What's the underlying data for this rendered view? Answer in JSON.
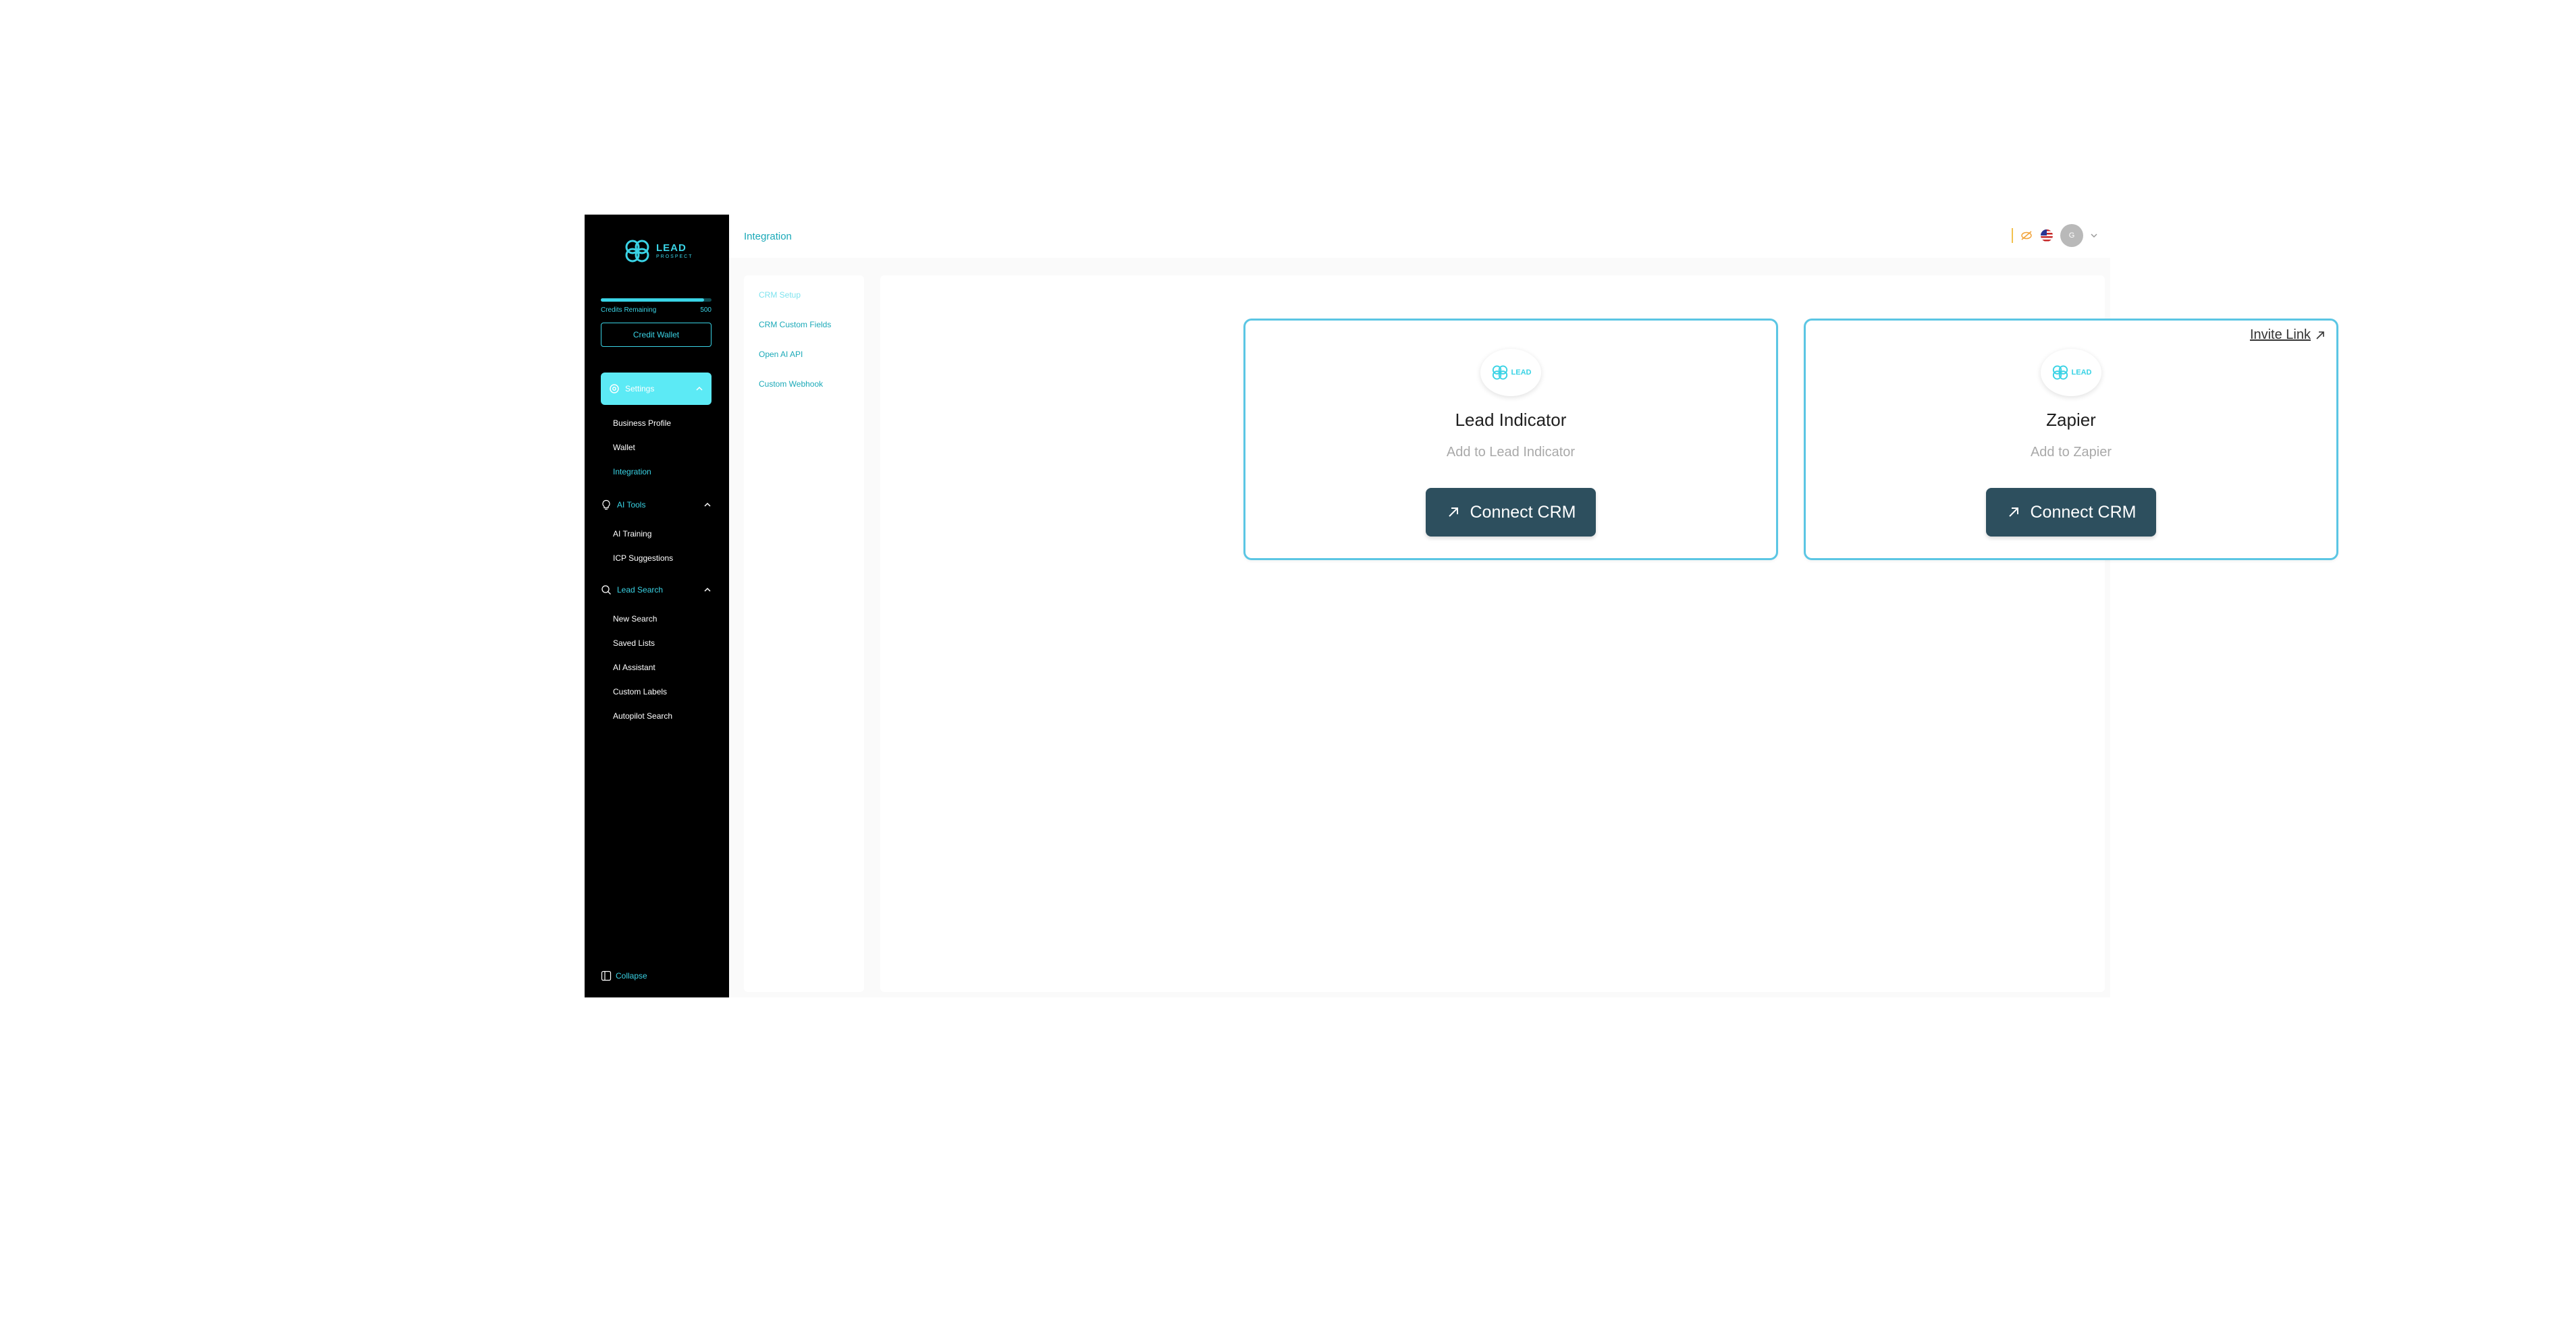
{
  "sidebar": {
    "logo": {
      "line1": "LEAD",
      "line2": "PROSPECT"
    },
    "credits": {
      "label": "Credits Remaining",
      "value": "500",
      "fill_fraction": 0.93
    },
    "credit_wallet_label": "Credit Wallet",
    "settings": {
      "label": "Settings",
      "items": [
        "Business Profile",
        "Wallet",
        "Integration"
      ]
    },
    "ai_tools": {
      "label": "AI Tools",
      "items": [
        "AI Training",
        "ICP Suggestions"
      ]
    },
    "lead_search": {
      "label": "Lead Search",
      "items": [
        "New Search",
        "Saved Lists",
        "AI Assistant",
        "Custom Labels",
        "Autopilot Search"
      ]
    },
    "collapse_label": "Collapse"
  },
  "header": {
    "title": "Integration",
    "avatar_initials": "G"
  },
  "subnav": {
    "items": [
      "CRM Setup",
      "CRM Custom Fields",
      "Open AI API",
      "Custom Webhook"
    ]
  },
  "cards": [
    {
      "logo_text": "LEAD",
      "title": "Lead Indicator",
      "subtitle": "Add to Lead Indicator",
      "button_label": "Connect CRM"
    },
    {
      "logo_text": "LEAD",
      "title": "Zapier",
      "subtitle": "Add to Zapier",
      "button_label": "Connect CRM",
      "link_label": "Invite Link"
    }
  ],
  "colors": {
    "accent": "#3ad3e5",
    "button": "#2d4f5e",
    "card_border": "#5bc6e4",
    "sidebar_bg": "#000000"
  }
}
